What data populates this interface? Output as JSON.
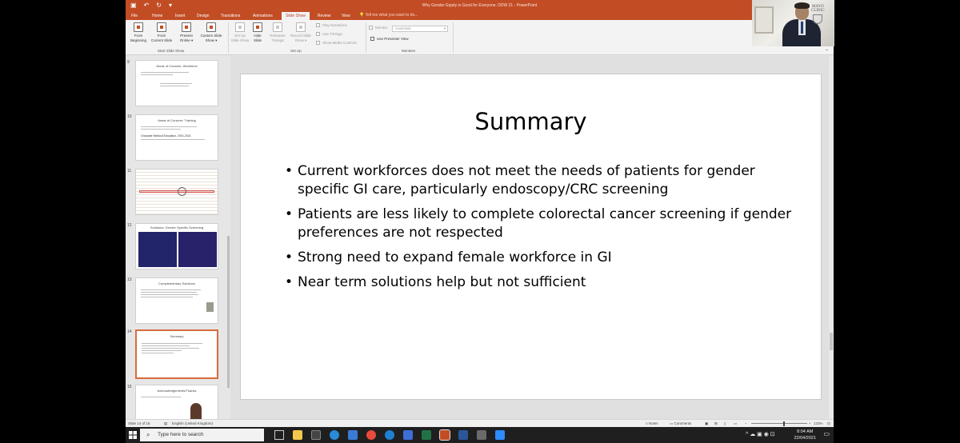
{
  "window": {
    "title": "Why Gender Equity is Good for Everyone. DDW 21 - PowerPoint"
  },
  "tabs": [
    {
      "label": "File"
    },
    {
      "label": "Home"
    },
    {
      "label": "Insert"
    },
    {
      "label": "Design"
    },
    {
      "label": "Transitions"
    },
    {
      "label": "Animations"
    },
    {
      "label": "Slide Show",
      "active": true
    },
    {
      "label": "Review"
    },
    {
      "label": "View"
    }
  ],
  "tell_me": "Tell me what you want to do...",
  "ribbon": {
    "start": {
      "from_beginning_1": "From",
      "from_beginning_2": "Beginning",
      "from_current_1": "From",
      "from_current_2": "Current Slide",
      "present_online_1": "Present",
      "present_online_2": "Online ▾",
      "custom_show_1": "Custom Slide",
      "custom_show_2": "Show ▾",
      "group": "Start Slide Show"
    },
    "setup": {
      "setup_1": "Set Up",
      "setup_2": "Slide Show",
      "hide_1": "Hide",
      "hide_2": "Slide",
      "rehearse_1": "Rehearse",
      "rehearse_2": "Timings",
      "record_1": "Record Slide",
      "record_2": "Show ▾",
      "play_narrations": "Play Narrations",
      "use_timings": "Use Timings",
      "show_media_controls": "Show Media Controls",
      "group": "Set Up"
    },
    "monitors": {
      "monitor_label": "Monitor:",
      "monitor_value": "Automatic",
      "use_presenter_view": "Use Presenter View",
      "group": "Monitors"
    }
  },
  "thumbnails": [
    {
      "num": "9",
      "title": "Areas of Concern: Workforce"
    },
    {
      "num": "10",
      "title": "Areas of Concern: Training",
      "sub": "Graduate Medical Education, 2001-2021"
    },
    {
      "num": "11",
      "title": ""
    },
    {
      "num": "12",
      "title": "Solutions: Gender Specific Screening"
    },
    {
      "num": "13",
      "title": "Complementary Solutions"
    },
    {
      "num": "14",
      "title": "Summary"
    },
    {
      "num": "15",
      "title": "Acknowledgements/Thanks"
    }
  ],
  "slide": {
    "title": "Summary",
    "bullets": [
      "Current workforces does not meet the needs of patients for gender specific GI care, particularly endoscopy/CRC screening",
      "Patients are less likely to complete colorectal cancer screening if gender preferences are not respected",
      "Strong need to expand female workforce in GI",
      "Near term solutions help but not sufficient"
    ]
  },
  "status": {
    "slide_of": "Slide 14 of 16",
    "language": "English (United Kingdom)",
    "notes": "Notes",
    "comments": "Comments",
    "zoom": "123%"
  },
  "taskbar": {
    "search_placeholder": "Type here to search",
    "time": "8:04 AM",
    "date": "22/04/2021"
  },
  "webcam": {
    "logo_line1": "MAYO",
    "logo_line2": "CLINIC"
  },
  "colors": {
    "accent": "#c24d25",
    "active_thumb_border": "#d86c3d"
  }
}
